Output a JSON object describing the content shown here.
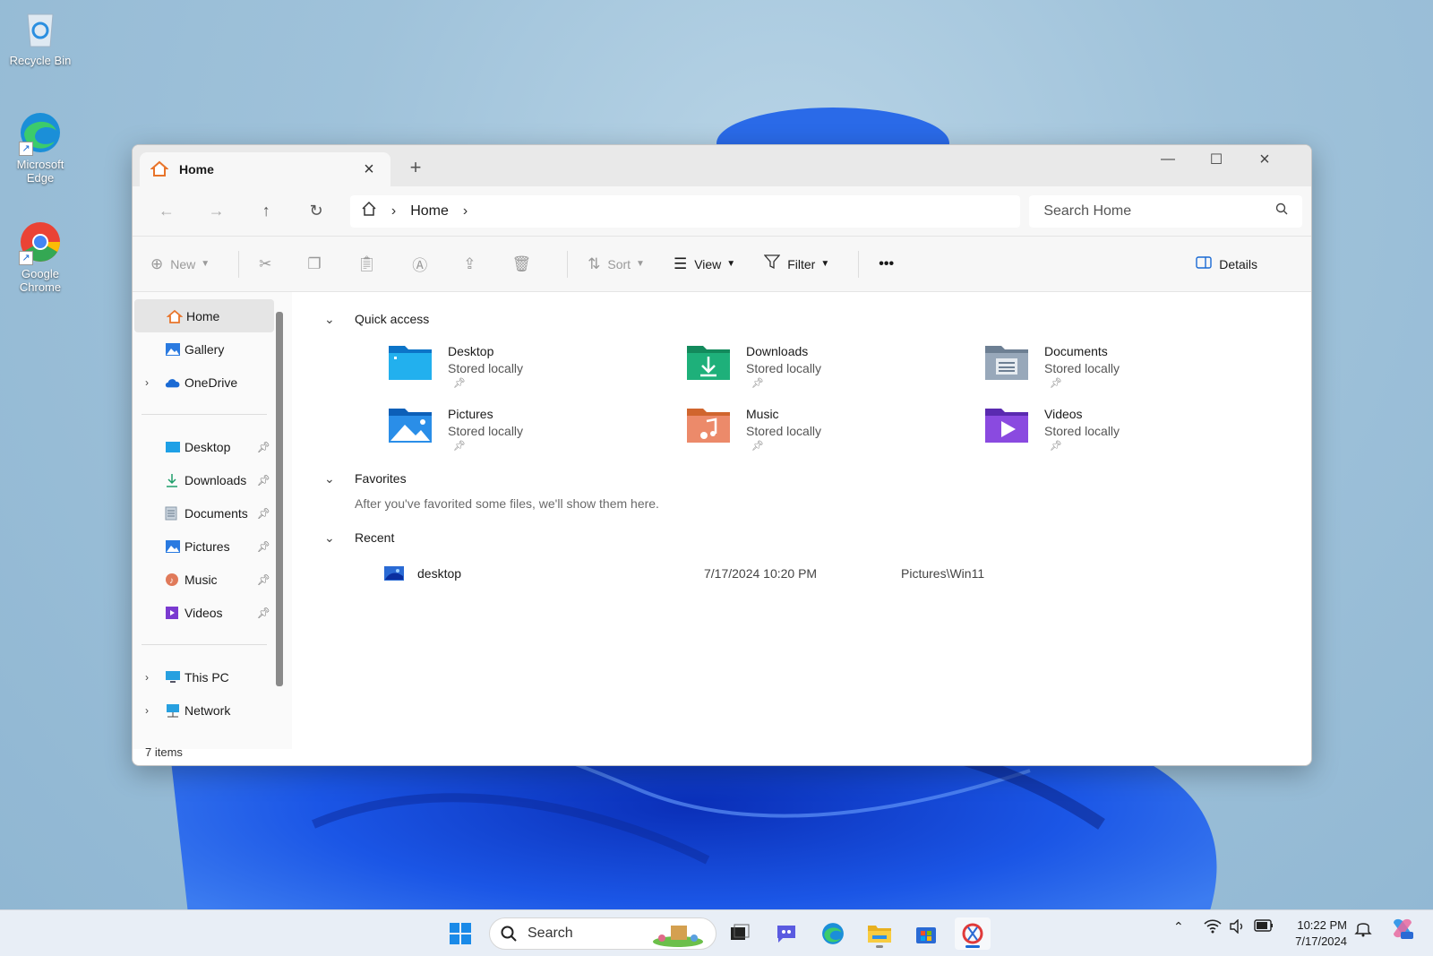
{
  "desktop": {
    "icons": [
      {
        "label": "Recycle Bin"
      },
      {
        "label": "Microsoft Edge"
      },
      {
        "label": "Google Chrome"
      }
    ]
  },
  "window": {
    "tab": {
      "title": "Home"
    },
    "breadcrumb": {
      "current": "Home"
    },
    "search": {
      "placeholder": "Search Home"
    },
    "commands": {
      "new": "New",
      "sort": "Sort",
      "view": "View",
      "filter": "Filter",
      "more": "•••",
      "details": "Details"
    },
    "sidebar": {
      "top": [
        {
          "label": "Home"
        },
        {
          "label": "Gallery"
        },
        {
          "label": "OneDrive"
        }
      ],
      "pinned": [
        {
          "label": "Desktop"
        },
        {
          "label": "Downloads"
        },
        {
          "label": "Documents"
        },
        {
          "label": "Pictures"
        },
        {
          "label": "Music"
        },
        {
          "label": "Videos"
        }
      ],
      "bottom": [
        {
          "label": "This PC"
        },
        {
          "label": "Network"
        }
      ]
    },
    "sections": {
      "quick_access": "Quick access",
      "favorites": "Favorites",
      "recent": "Recent"
    },
    "quick_access": [
      {
        "name": "Desktop",
        "status": "Stored locally"
      },
      {
        "name": "Downloads",
        "status": "Stored locally"
      },
      {
        "name": "Documents",
        "status": "Stored locally"
      },
      {
        "name": "Pictures",
        "status": "Stored locally"
      },
      {
        "name": "Music",
        "status": "Stored locally"
      },
      {
        "name": "Videos",
        "status": "Stored locally"
      }
    ],
    "favorites_message": "After you've favorited some files, we'll show them here.",
    "recent": [
      {
        "name": "desktop",
        "date": "7/17/2024 10:20 PM",
        "location": "Pictures\\Win11"
      }
    ],
    "status": "7 items"
  },
  "taskbar": {
    "search_label": "Search",
    "time": "10:22 PM",
    "date": "7/17/2024"
  },
  "colors": {
    "accent": "#1a6ad4",
    "window_bg": "#ffffff",
    "chrome_bg": "#f7f7f7"
  }
}
